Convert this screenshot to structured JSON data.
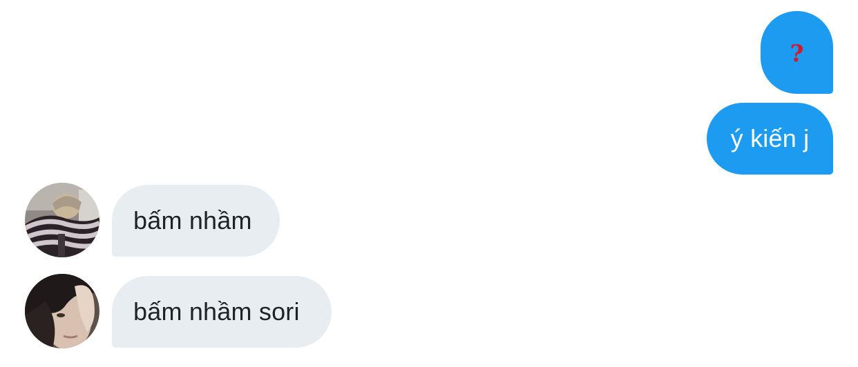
{
  "conversation": {
    "messages": [
      {
        "sender": "me",
        "text": "❓"
      },
      {
        "sender": "me",
        "text": "ý kiến j"
      },
      {
        "sender": "them",
        "text": "bấm nhầm"
      },
      {
        "sender": "them",
        "text": "bấm nhầm sori"
      }
    ]
  },
  "colors": {
    "outgoing_bubble": "#1d9bf0",
    "incoming_bubble": "#e8edf1",
    "outgoing_text": "#ffffff",
    "incoming_text": "#1e2328",
    "question_mark": "#d11a2a"
  },
  "icons": {
    "message_1": "question-mark-emoji"
  }
}
